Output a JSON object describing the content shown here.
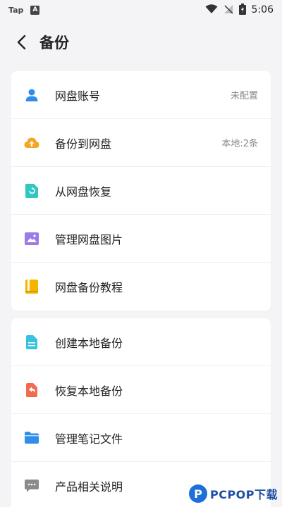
{
  "status_bar": {
    "carrier_label": "Tap",
    "badge_letter": "A",
    "time": "5:06"
  },
  "header": {
    "title": "备份"
  },
  "cloud_section": {
    "items": [
      {
        "label": "网盘账号",
        "value": "未配置",
        "icon": "user-icon",
        "color": "#2f8ee8"
      },
      {
        "label": "备份到网盘",
        "value": "本地:2条",
        "icon": "cloud-upload-icon",
        "color": "#f5a623"
      },
      {
        "label": "从网盘恢复",
        "icon": "restore-file-icon",
        "color": "#2fc7c0"
      },
      {
        "label": "管理网盘图片",
        "icon": "image-icon",
        "color": "#9b7be6"
      },
      {
        "label": "网盘备份教程",
        "icon": "book-icon",
        "color": "#f5b400"
      }
    ]
  },
  "local_section": {
    "items": [
      {
        "label": "创建本地备份",
        "icon": "document-icon",
        "color": "#35c3e0"
      },
      {
        "label": "恢复本地备份",
        "icon": "undo-file-icon",
        "color": "#f06b4f"
      },
      {
        "label": "管理笔记文件",
        "icon": "folder-icon",
        "color": "#2f8ee8"
      },
      {
        "label": "产品相关说明",
        "icon": "chat-bubble-icon",
        "color": "#8a8a8a"
      }
    ]
  },
  "watermark": {
    "logo_letter": "P",
    "text": "PCPOP下载"
  }
}
